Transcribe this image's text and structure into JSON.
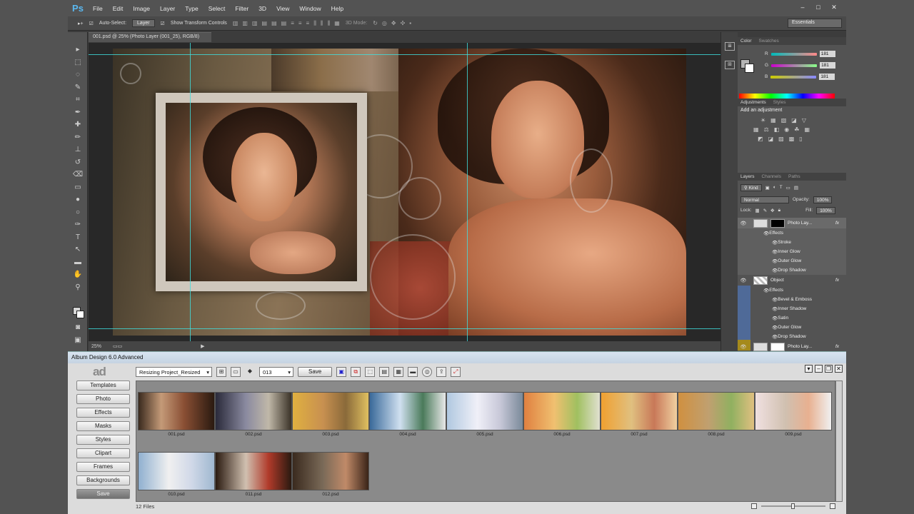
{
  "photoshop": {
    "logo": "Ps",
    "menu": [
      "File",
      "Edit",
      "Image",
      "Layer",
      "Type",
      "Select",
      "Filter",
      "3D",
      "View",
      "Window",
      "Help"
    ],
    "window_controls": [
      "–",
      "□",
      "✕"
    ],
    "options": {
      "auto_select_label": "Auto-Select:",
      "auto_select_value": "Layer",
      "show_transform_label": "Show Transform Controls",
      "mode_3d_label": "3D Mode:",
      "workspace": "Essentials"
    },
    "doc_tab": "001.psd @ 25% (Photo Layer (001_25), RGB/8)",
    "zoom": "25%",
    "color_panel": {
      "tabs": [
        "Color",
        "Swatches"
      ],
      "r_label": "R",
      "g_label": "G",
      "b_label": "B",
      "r": "181",
      "g": "181",
      "b": "181"
    },
    "adjustments": {
      "tabs": [
        "Adjustments",
        "Styles"
      ],
      "title": "Add an adjustment"
    },
    "layers": {
      "tabs": [
        "Layers",
        "Channels",
        "Paths"
      ],
      "kind": "Kind",
      "blend_mode": "Normal",
      "opacity_label": "Opacity:",
      "opacity": "100%",
      "lock_label": "Lock:",
      "fill_label": "Fill:",
      "fill": "100%",
      "layer1": {
        "name": "Photo Lay...",
        "fx": "fx",
        "effects_label": "Effects",
        "effects": [
          "Stroke",
          "Inner Glow",
          "Outer Glow",
          "Drop Shadow"
        ]
      },
      "layer2": {
        "name": "Object",
        "fx": "fx",
        "effects_label": "Effects",
        "effects": [
          "Bevel & Emboss",
          "Inner Shadow",
          "Satin",
          "Outer Glow",
          "Drop Shadow"
        ]
      },
      "layer3": {
        "name": "Photo Lay...",
        "fx": "fx"
      },
      "layer1_color": "#a58a1c",
      "layer2_color": "#4f6a98"
    }
  },
  "album": {
    "title": "Album Design 6.0 Advanced",
    "logo": "ad",
    "side_buttons": [
      "Templates",
      "Photo",
      "Effects",
      "Masks",
      "Styles",
      "Clipart",
      "Frames",
      "Backgrounds",
      "Save"
    ],
    "project": "Resizing Project_Resized",
    "page_number": "013",
    "save_label": "Save",
    "thumbnails": [
      "001.psd",
      "002.psd",
      "003.psd",
      "004.psd",
      "005.psd",
      "006.psd",
      "007.psd",
      "008.psd",
      "009.psd",
      "010.psd",
      "011.psd",
      "012.psd"
    ],
    "status": "12 Files"
  }
}
